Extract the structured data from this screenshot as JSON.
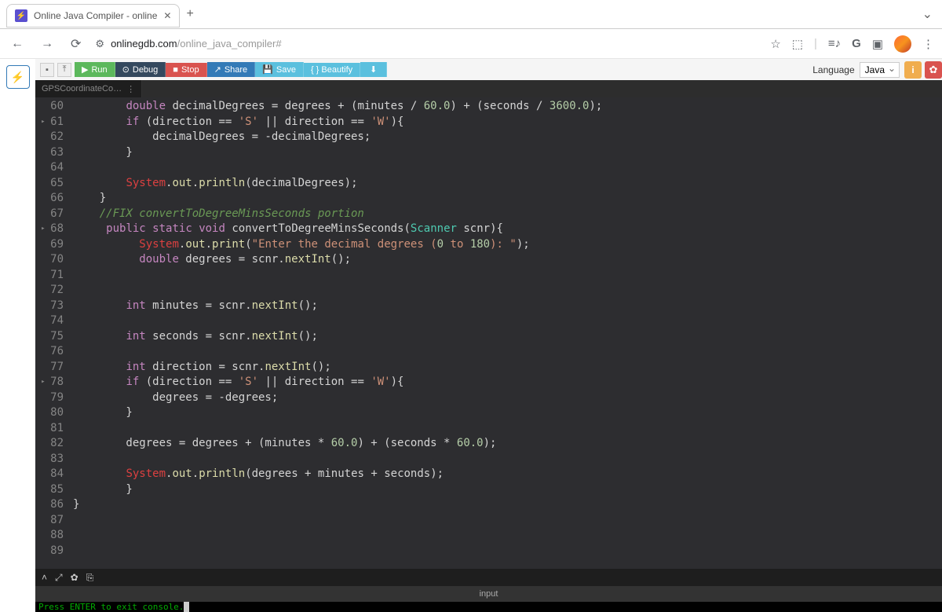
{
  "browser": {
    "tab_title": "Online Java Compiler - online",
    "url_host": "onlinegdb.com",
    "url_path": "/online_java_compiler#"
  },
  "toolbar": {
    "run": "Run",
    "debug": "Debug",
    "stop": "Stop",
    "share": "Share",
    "save": "Save",
    "beautify": "{ } Beautify",
    "language_label": "Language",
    "language_value": "Java"
  },
  "file_tab": "GPSCoordinateCo…",
  "code": {
    "lines": [
      {
        "n": "60",
        "t": "        double decimalDegrees = degrees + (minutes / 60.0) + (seconds / 3600.0);"
      },
      {
        "n": "61",
        "f": true,
        "t": "        if (direction == 'S' || direction == 'W'){"
      },
      {
        "n": "62",
        "t": "            decimalDegrees = -decimalDegrees;"
      },
      {
        "n": "63",
        "t": "        }"
      },
      {
        "n": "64",
        "t": ""
      },
      {
        "n": "65",
        "t": "        System.out.println(decimalDegrees);"
      },
      {
        "n": "66",
        "t": "    }"
      },
      {
        "n": "67",
        "t": "    //FIX convertToDegreeMinsSeconds portion"
      },
      {
        "n": "68",
        "f": true,
        "t": "     public static void convertToDegreeMinsSeconds(Scanner scnr){"
      },
      {
        "n": "69",
        "t": "          System.out.print(\"Enter the decimal degrees (0 to 180): \");"
      },
      {
        "n": "70",
        "t": "          double degrees = scnr.nextInt();"
      },
      {
        "n": "71",
        "t": ""
      },
      {
        "n": "72",
        "t": ""
      },
      {
        "n": "73",
        "t": "        int minutes = scnr.nextInt();"
      },
      {
        "n": "74",
        "t": ""
      },
      {
        "n": "75",
        "t": "        int seconds = scnr.nextInt();"
      },
      {
        "n": "76",
        "t": ""
      },
      {
        "n": "77",
        "t": "        int direction = scnr.nextInt();"
      },
      {
        "n": "78",
        "f": true,
        "t": "        if (direction == 'S' || direction == 'W'){"
      },
      {
        "n": "79",
        "t": "            degrees = -degrees;"
      },
      {
        "n": "80",
        "t": "        }"
      },
      {
        "n": "81",
        "t": ""
      },
      {
        "n": "82",
        "t": "        degrees = degrees + (minutes * 60.0) + (seconds * 60.0);"
      },
      {
        "n": "83",
        "t": ""
      },
      {
        "n": "84",
        "t": "        System.out.println(degrees + minutes + seconds);"
      },
      {
        "n": "85",
        "t": "        }"
      },
      {
        "n": "86",
        "t": "}"
      },
      {
        "n": "87",
        "t": ""
      },
      {
        "n": "88",
        "t": ""
      },
      {
        "n": "89",
        "t": ""
      }
    ]
  },
  "console": {
    "tab": "input",
    "text": "Press ENTER to exit console."
  }
}
